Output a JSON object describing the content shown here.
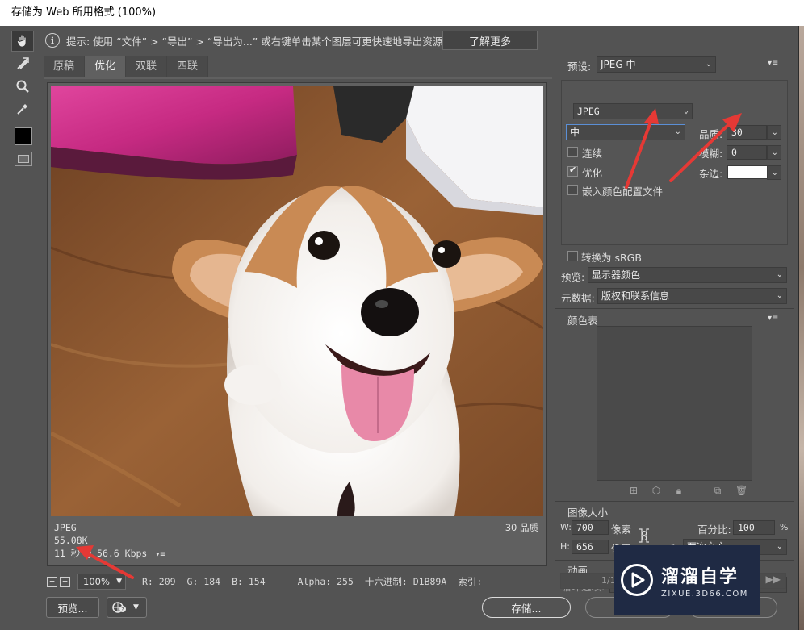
{
  "window": {
    "title": "存储为 Web 所用格式 (100%)"
  },
  "tools": [
    {
      "icon": "hand-icon"
    },
    {
      "icon": "slice-select-icon"
    },
    {
      "icon": "zoom-icon"
    },
    {
      "icon": "eyedropper-icon"
    }
  ],
  "hint": {
    "text": "提示: 使用 “文件” > “导出” > “导出为...” 或右键单击某个图层可更快速地导出资源",
    "learn_more": "了解更多"
  },
  "tabs": [
    "原稿",
    "优化",
    "双联",
    "四联"
  ],
  "active_tab": 1,
  "preview": {
    "format": "JPEG",
    "size": "55.08K",
    "download": "11 秒 @ 56.6 Kbps",
    "quality_text": "30 品质"
  },
  "status": {
    "zoom": "100%",
    "r": "R: 209",
    "g": "G: 184",
    "b": "B: 154",
    "alpha": "Alpha: 255",
    "hex": "十六进制: D1B89A",
    "index": "索引: —"
  },
  "buttons": {
    "preview": "预览...",
    "save": "存储..."
  },
  "settings": {
    "preset_label": "预设:",
    "preset_value": "JPEG 中",
    "format_value": "JPEG",
    "quality_level": "中",
    "quality_label": "品质:",
    "quality_value": "30",
    "blur_label": "模糊:",
    "blur_value": "0",
    "matte_label": "杂边:",
    "progressive_label": "连续",
    "progressive_checked": false,
    "optimized_label": "优化",
    "optimized_checked": true,
    "embed_profile_label": "嵌入颜色配置文件",
    "embed_profile_checked": false,
    "convert_srgb_label": "转换为 sRGB",
    "convert_srgb_checked": false,
    "preview_label": "预览:",
    "preview_value": "显示器颜色",
    "metadata_label": "元数据:",
    "metadata_value": "版权和联系信息"
  },
  "color_table": {
    "title": "颜色表"
  },
  "image_size": {
    "title": "图像大小",
    "w_label": "W:",
    "w_value": "700",
    "h_label": "H:",
    "h_value": "656",
    "unit": "像素",
    "percent_label": "百分比:",
    "percent_value": "100",
    "percent_unit": "%",
    "quality_label": "品质:",
    "quality_value": "两次立方"
  },
  "animation": {
    "title": "动画",
    "loop_label": "循环选项:",
    "frame_counter": "1/1"
  },
  "watermark": {
    "title": "溜溜自学",
    "subtitle": "ZIXUE.3D66.COM"
  },
  "colors": {
    "dialog_bg": "#535353",
    "arrow_red": "#e53935",
    "focus_blue": "#5b8fd6",
    "watermark_bg": "#1f2a44"
  }
}
